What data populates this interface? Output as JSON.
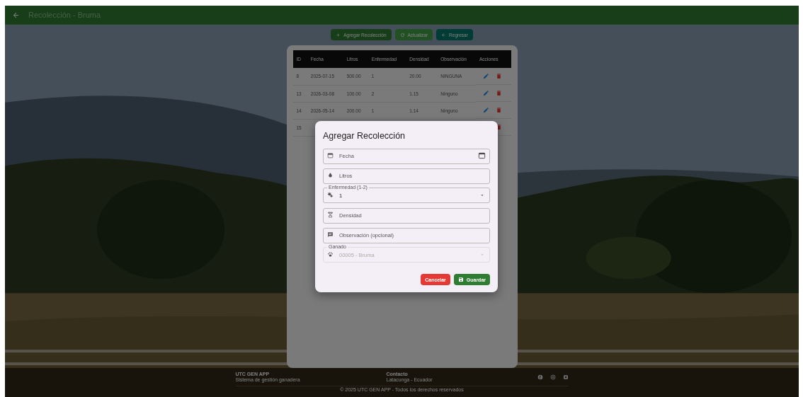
{
  "app_bar": {
    "title": "Recolección - Bruma"
  },
  "actions": [
    {
      "label": "Agregar Recolección",
      "kind": "add"
    },
    {
      "label": "Actualizar",
      "kind": "refresh"
    },
    {
      "label": "Regresar",
      "kind": "back"
    }
  ],
  "table": {
    "columns": [
      "ID",
      "Fecha",
      "Litros",
      "Enfermedad",
      "Densidad",
      "Observación",
      "Acciones"
    ],
    "rows": [
      {
        "cells": [
          "8",
          "2025-07-15",
          "500.00",
          "1",
          "20.00",
          "NINGUNA"
        ]
      },
      {
        "cells": [
          "13",
          "2026-03-08",
          "100.00",
          "2",
          "1.15",
          "Ninguno"
        ]
      },
      {
        "cells": [
          "14",
          "2026-05-14",
          "200.00",
          "1",
          "1.14",
          "Ninguno"
        ]
      },
      {
        "cells": [
          "15"
        ]
      }
    ]
  },
  "dialog": {
    "title": "Agregar Recolección",
    "fields": [
      {
        "kind": "date",
        "placeholder": "Fecha"
      },
      {
        "kind": "text",
        "placeholder": "Litros"
      },
      {
        "kind": "select",
        "label": "Enfermedad (1-2)",
        "value": "1",
        "disabled": false
      },
      {
        "kind": "text",
        "placeholder": "Densidad"
      },
      {
        "kind": "text",
        "placeholder": "Observación (opcional)"
      },
      {
        "kind": "select",
        "label": "Ganado",
        "value": "00005 - Bruma",
        "disabled": true
      }
    ],
    "buttons": [
      {
        "label": "Cancelar",
        "kind": "cancel"
      },
      {
        "label": "Guardar",
        "kind": "save"
      }
    ]
  },
  "footer": {
    "brand": "UTC GEN APP",
    "tagline": "Sistema de gestión ganadera",
    "contact_title": "Contacto",
    "contact": "Latacunga - Ecuador",
    "copyright": "© 2025 UTC GEN APP - Todos los derechos reservados"
  }
}
